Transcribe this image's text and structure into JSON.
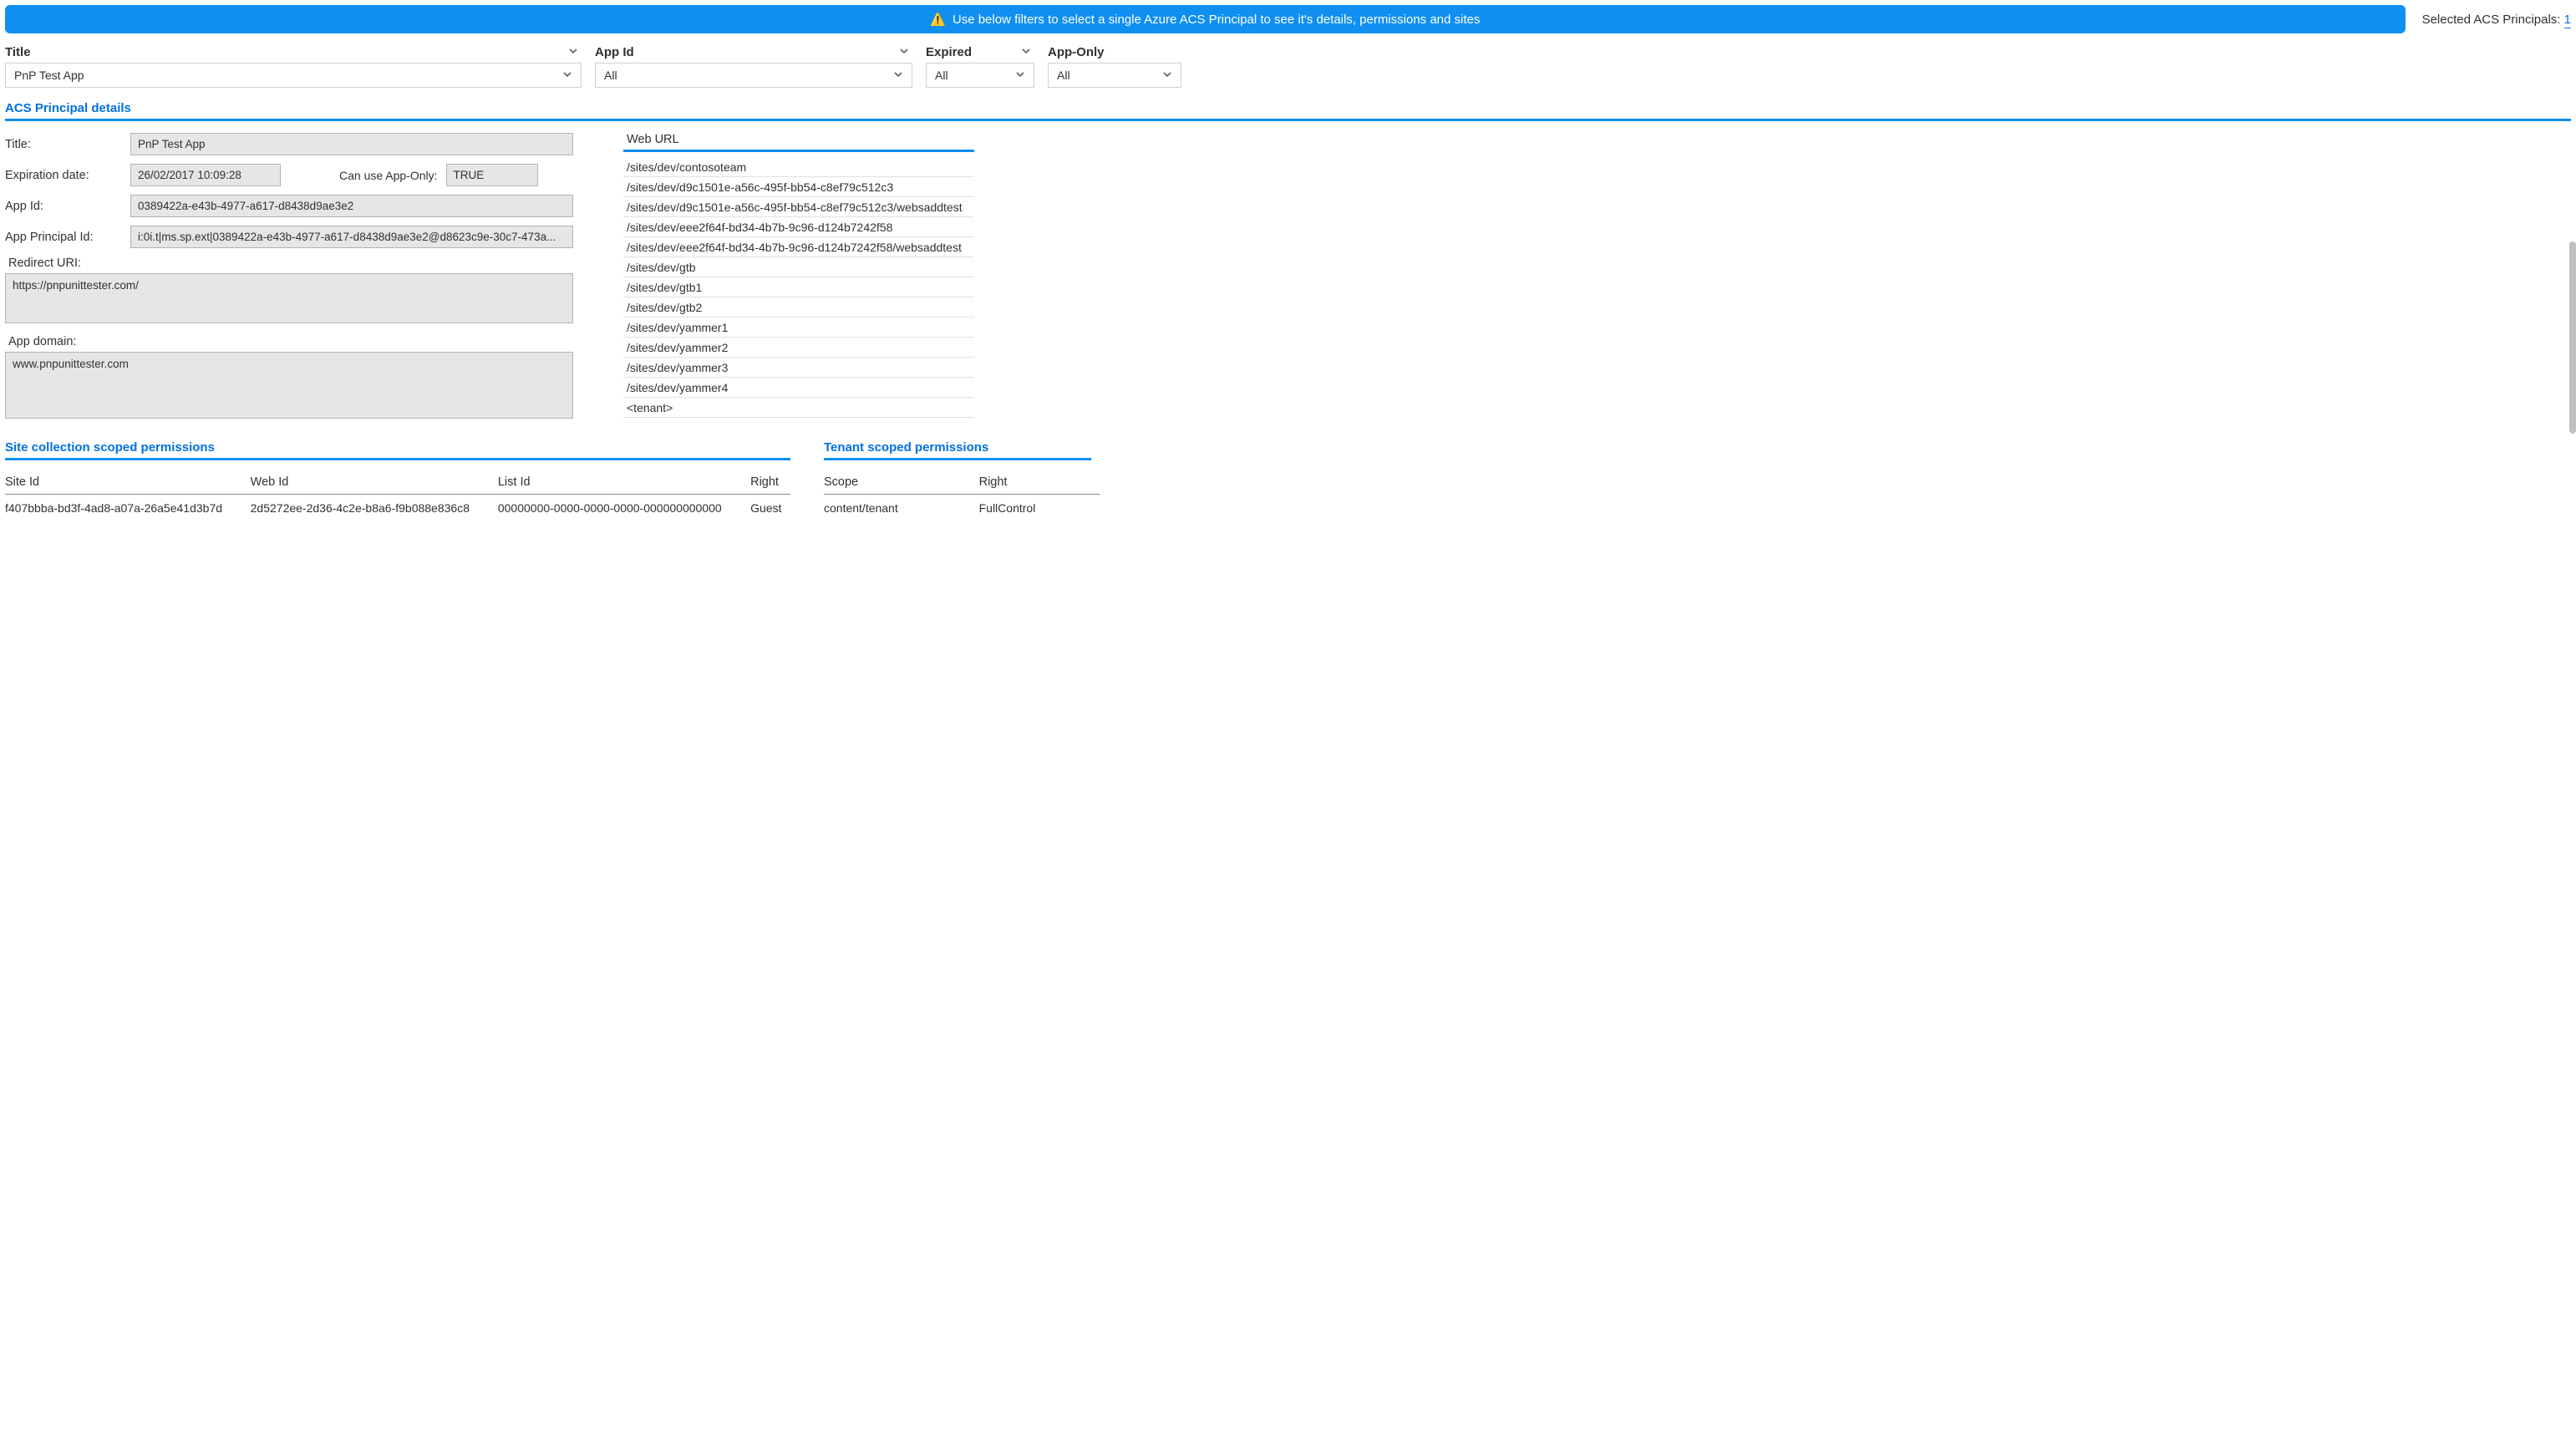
{
  "banner": {
    "icon": "⚠️",
    "text": "Use below filters to select a single Azure ACS Principal to see it's details, permissions and sites"
  },
  "selected": {
    "label": "Selected ACS Principals:",
    "count": "1"
  },
  "filters": {
    "title": {
      "label": "Title",
      "value": "PnP Test App"
    },
    "appid": {
      "label": "App Id",
      "value": "All"
    },
    "expired": {
      "label": "Expired",
      "value": "All"
    },
    "apponly": {
      "label": "App-Only",
      "value": "All"
    }
  },
  "details_section": "ACS Principal details",
  "details": {
    "title_label": "Title:",
    "title_value": "PnP Test App",
    "expiration_label": "Expiration date:",
    "expiration_value": "26/02/2017 10:09:28",
    "apponly_label": "Can use App-Only:",
    "apponly_value": "TRUE",
    "appid_label": "App Id:",
    "appid_value": "0389422a-e43b-4977-a617-d8438d9ae3e2",
    "principalid_label": "App Principal Id:",
    "principalid_value": "i:0i.t|ms.sp.ext|0389422a-e43b-4977-a617-d8438d9ae3e2@d8623c9e-30c7-473a...",
    "redirect_label": "Redirect URI:",
    "redirect_value": "https://pnpunittester.com/",
    "domain_label": "App domain:",
    "domain_value": "www.pnpunittester.com"
  },
  "weburl": {
    "header": "Web URL",
    "items": [
      "/sites/dev/contosoteam",
      "/sites/dev/d9c1501e-a56c-495f-bb54-c8ef79c512c3",
      "/sites/dev/d9c1501e-a56c-495f-bb54-c8ef79c512c3/websaddtest",
      "/sites/dev/eee2f64f-bd34-4b7b-9c96-d124b7242f58",
      "/sites/dev/eee2f64f-bd34-4b7b-9c96-d124b7242f58/websaddtest",
      "/sites/dev/gtb",
      "/sites/dev/gtb1",
      "/sites/dev/gtb2",
      "/sites/dev/yammer1",
      "/sites/dev/yammer2",
      "/sites/dev/yammer3",
      "/sites/dev/yammer4",
      "<tenant>"
    ]
  },
  "site_perms": {
    "header": "Site collection scoped permissions",
    "cols": [
      "Site Id",
      "Web Id",
      "List Id",
      "Right"
    ],
    "rows": [
      [
        "f407bbba-bd3f-4ad8-a07a-26a5e41d3b7d",
        "2d5272ee-2d36-4c2e-b8a6-f9b088e836c8",
        "00000000-0000-0000-0000-000000000000",
        "Guest"
      ]
    ]
  },
  "tenant_perms": {
    "header": "Tenant scoped permissions",
    "cols": [
      "Scope",
      "Right"
    ],
    "rows": [
      [
        "content/tenant",
        "FullControl"
      ]
    ]
  }
}
